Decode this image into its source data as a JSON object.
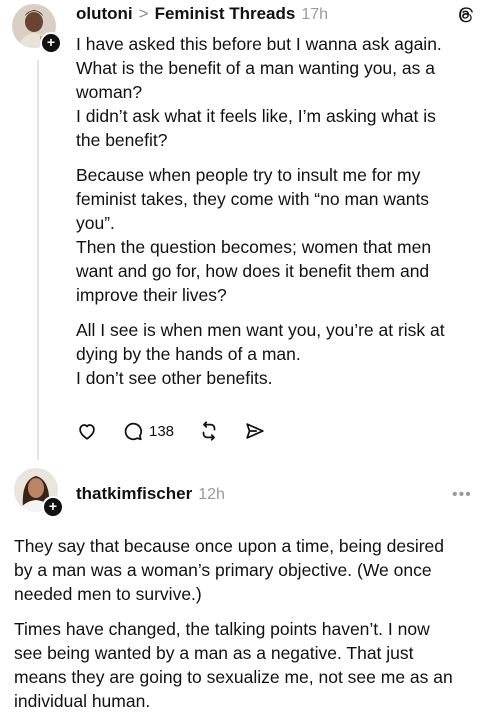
{
  "post1": {
    "username": "olutoni",
    "chevron": ">",
    "thread_name": "Feminist Threads",
    "time": "17h",
    "paragraphs": [
      [
        "I have asked this before but I wanna ask again.",
        "What is the benefit of a man wanting you, as a",
        "woman?",
        "I didn’t ask what it feels like, I’m asking what is",
        "the benefit?"
      ],
      [
        "Because when people try to insult me for my",
        "feminist takes, they come with “no man wants",
        "you”.",
        "Then the question becomes; women that men",
        "want and go for, how does it benefit them and",
        "improve their lives?"
      ],
      [
        "All I see is when men want you, you’re at risk at",
        "dying by the hands of a man.",
        "I don’t see other benefits."
      ]
    ],
    "actions": {
      "like_icon": "heart-icon",
      "comment_icon": "comment-icon",
      "comment_count": "138",
      "repost_icon": "repost-icon",
      "share_icon": "share-icon"
    },
    "logo_icon": "threads-logo-icon"
  },
  "post2": {
    "username": "thatkimfischer",
    "time": "12h",
    "more": "•••",
    "paragraphs": [
      [
        "They say that because once upon a time, being desired",
        "by a man was a woman’s primary objective. (We once",
        "needed men to survive.)"
      ],
      [
        "Times have changed, the talking points haven’t. I now",
        "see being wanted by a man as a negative. That just",
        "means they are going to sexualize me, not see me as an",
        "individual human."
      ]
    ]
  },
  "colors": {
    "text": "#111111",
    "muted": "#9a9a9a",
    "divider": "#e4e4e4"
  }
}
